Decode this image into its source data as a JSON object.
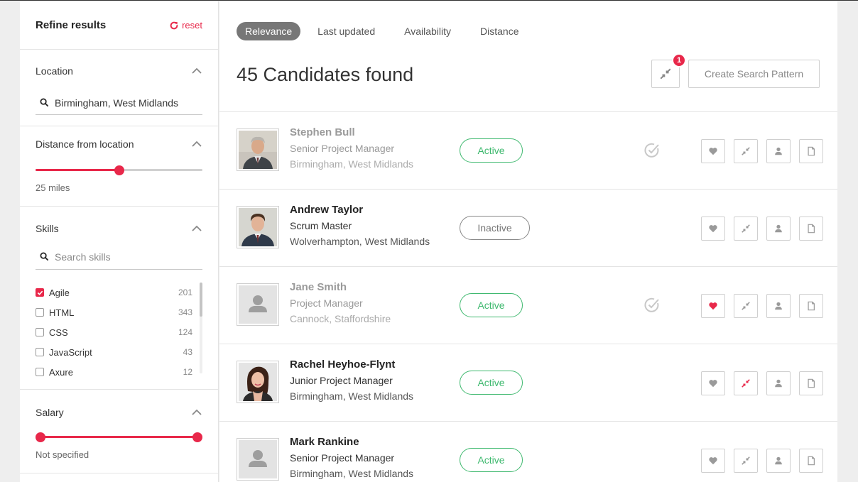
{
  "sidebar": {
    "title": "Refine results",
    "reset_label": "reset",
    "location": {
      "title": "Location",
      "value": "Birmingham, West Midlands"
    },
    "distance": {
      "title": "Distance from location",
      "value_label": "25 miles",
      "level_fraction": 0.5
    },
    "skills": {
      "title": "Skills",
      "search_placeholder": "Search skills",
      "items": [
        {
          "label": "Agile",
          "count": "201",
          "checked": true
        },
        {
          "label": "HTML",
          "count": "343",
          "checked": false
        },
        {
          "label": "CSS",
          "count": "124",
          "checked": false
        },
        {
          "label": "JavaScript",
          "count": "43",
          "checked": false
        },
        {
          "label": "Axure",
          "count": "12",
          "checked": false
        }
      ]
    },
    "salary": {
      "title": "Salary",
      "value_label": "Not specified",
      "range_fraction": [
        0.03,
        0.97
      ]
    }
  },
  "main": {
    "sort_tabs": [
      {
        "label": "Relevance",
        "active": true
      },
      {
        "label": "Last updated",
        "active": false
      },
      {
        "label": "Availability",
        "active": false
      },
      {
        "label": "Distance",
        "active": false
      }
    ],
    "results_title": "45 Candidates found",
    "compare_count": "1",
    "create_pattern_label": "Create Search Pattern",
    "candidates": [
      {
        "name": "Stephen Bull",
        "role": "Senior Project Manager",
        "location": "Birmingham, West Midlands",
        "status": "Active",
        "viewed": true,
        "favourite": false,
        "compared": false,
        "photo": "photo-older-man"
      },
      {
        "name": "Andrew Taylor",
        "role": "Scrum Master",
        "location": "Wolverhampton, West Midlands",
        "status": "Inactive",
        "viewed": false,
        "favourite": false,
        "compared": false,
        "photo": "photo-young-man"
      },
      {
        "name": "Jane Smith",
        "role": "Project Manager",
        "location": "Cannock, Staffordshire",
        "status": "Active",
        "viewed": true,
        "favourite": true,
        "compared": false,
        "photo": "placeholder"
      },
      {
        "name": "Rachel Heyhoe-Flynt",
        "role": "Junior Project Manager",
        "location": "Birmingham, West Midlands",
        "status": "Active",
        "viewed": false,
        "favourite": false,
        "compared": true,
        "photo": "photo-woman"
      },
      {
        "name": "Mark Rankine",
        "role": "Senior Project Manager",
        "location": "Birmingham, West Midlands",
        "status": "Active",
        "viewed": false,
        "favourite": false,
        "compared": false,
        "photo": "placeholder"
      }
    ]
  },
  "colors": {
    "accent": "#e8284a",
    "active_green": "#3fb96f",
    "icon_grey": "#9a9a9a"
  }
}
